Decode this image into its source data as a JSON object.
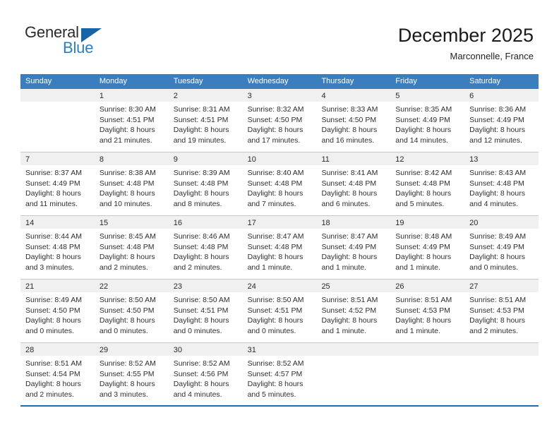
{
  "brand": {
    "name_top": "General",
    "name_bottom": "Blue",
    "triangle_icon": "blue-triangle-icon",
    "accent_color": "#2a7fc4"
  },
  "header": {
    "title": "December 2025",
    "subtitle": "Marconnelle, France"
  },
  "colors": {
    "header_row_bg": "#3b7ebf",
    "daynum_band_bg": "#f0f0f0",
    "row_divider": "#c8c8c8",
    "last_row_divider": "#1f6bb0",
    "text": "#2e2e2e"
  },
  "weekdays": [
    "Sunday",
    "Monday",
    "Tuesday",
    "Wednesday",
    "Thursday",
    "Friday",
    "Saturday"
  ],
  "weeks": [
    [
      {
        "day": "",
        "lines": []
      },
      {
        "day": "1",
        "lines": [
          "Sunrise: 8:30 AM",
          "Sunset: 4:51 PM",
          "Daylight: 8 hours",
          "and 21 minutes."
        ]
      },
      {
        "day": "2",
        "lines": [
          "Sunrise: 8:31 AM",
          "Sunset: 4:51 PM",
          "Daylight: 8 hours",
          "and 19 minutes."
        ]
      },
      {
        "day": "3",
        "lines": [
          "Sunrise: 8:32 AM",
          "Sunset: 4:50 PM",
          "Daylight: 8 hours",
          "and 17 minutes."
        ]
      },
      {
        "day": "4",
        "lines": [
          "Sunrise: 8:33 AM",
          "Sunset: 4:50 PM",
          "Daylight: 8 hours",
          "and 16 minutes."
        ]
      },
      {
        "day": "5",
        "lines": [
          "Sunrise: 8:35 AM",
          "Sunset: 4:49 PM",
          "Daylight: 8 hours",
          "and 14 minutes."
        ]
      },
      {
        "day": "6",
        "lines": [
          "Sunrise: 8:36 AM",
          "Sunset: 4:49 PM",
          "Daylight: 8 hours",
          "and 12 minutes."
        ]
      }
    ],
    [
      {
        "day": "7",
        "lines": [
          "Sunrise: 8:37 AM",
          "Sunset: 4:49 PM",
          "Daylight: 8 hours",
          "and 11 minutes."
        ]
      },
      {
        "day": "8",
        "lines": [
          "Sunrise: 8:38 AM",
          "Sunset: 4:48 PM",
          "Daylight: 8 hours",
          "and 10 minutes."
        ]
      },
      {
        "day": "9",
        "lines": [
          "Sunrise: 8:39 AM",
          "Sunset: 4:48 PM",
          "Daylight: 8 hours",
          "and 8 minutes."
        ]
      },
      {
        "day": "10",
        "lines": [
          "Sunrise: 8:40 AM",
          "Sunset: 4:48 PM",
          "Daylight: 8 hours",
          "and 7 minutes."
        ]
      },
      {
        "day": "11",
        "lines": [
          "Sunrise: 8:41 AM",
          "Sunset: 4:48 PM",
          "Daylight: 8 hours",
          "and 6 minutes."
        ]
      },
      {
        "day": "12",
        "lines": [
          "Sunrise: 8:42 AM",
          "Sunset: 4:48 PM",
          "Daylight: 8 hours",
          "and 5 minutes."
        ]
      },
      {
        "day": "13",
        "lines": [
          "Sunrise: 8:43 AM",
          "Sunset: 4:48 PM",
          "Daylight: 8 hours",
          "and 4 minutes."
        ]
      }
    ],
    [
      {
        "day": "14",
        "lines": [
          "Sunrise: 8:44 AM",
          "Sunset: 4:48 PM",
          "Daylight: 8 hours",
          "and 3 minutes."
        ]
      },
      {
        "day": "15",
        "lines": [
          "Sunrise: 8:45 AM",
          "Sunset: 4:48 PM",
          "Daylight: 8 hours",
          "and 2 minutes."
        ]
      },
      {
        "day": "16",
        "lines": [
          "Sunrise: 8:46 AM",
          "Sunset: 4:48 PM",
          "Daylight: 8 hours",
          "and 2 minutes."
        ]
      },
      {
        "day": "17",
        "lines": [
          "Sunrise: 8:47 AM",
          "Sunset: 4:48 PM",
          "Daylight: 8 hours",
          "and 1 minute."
        ]
      },
      {
        "day": "18",
        "lines": [
          "Sunrise: 8:47 AM",
          "Sunset: 4:49 PM",
          "Daylight: 8 hours",
          "and 1 minute."
        ]
      },
      {
        "day": "19",
        "lines": [
          "Sunrise: 8:48 AM",
          "Sunset: 4:49 PM",
          "Daylight: 8 hours",
          "and 1 minute."
        ]
      },
      {
        "day": "20",
        "lines": [
          "Sunrise: 8:49 AM",
          "Sunset: 4:49 PM",
          "Daylight: 8 hours",
          "and 0 minutes."
        ]
      }
    ],
    [
      {
        "day": "21",
        "lines": [
          "Sunrise: 8:49 AM",
          "Sunset: 4:50 PM",
          "Daylight: 8 hours",
          "and 0 minutes."
        ]
      },
      {
        "day": "22",
        "lines": [
          "Sunrise: 8:50 AM",
          "Sunset: 4:50 PM",
          "Daylight: 8 hours",
          "and 0 minutes."
        ]
      },
      {
        "day": "23",
        "lines": [
          "Sunrise: 8:50 AM",
          "Sunset: 4:51 PM",
          "Daylight: 8 hours",
          "and 0 minutes."
        ]
      },
      {
        "day": "24",
        "lines": [
          "Sunrise: 8:50 AM",
          "Sunset: 4:51 PM",
          "Daylight: 8 hours",
          "and 0 minutes."
        ]
      },
      {
        "day": "25",
        "lines": [
          "Sunrise: 8:51 AM",
          "Sunset: 4:52 PM",
          "Daylight: 8 hours",
          "and 1 minute."
        ]
      },
      {
        "day": "26",
        "lines": [
          "Sunrise: 8:51 AM",
          "Sunset: 4:53 PM",
          "Daylight: 8 hours",
          "and 1 minute."
        ]
      },
      {
        "day": "27",
        "lines": [
          "Sunrise: 8:51 AM",
          "Sunset: 4:53 PM",
          "Daylight: 8 hours",
          "and 2 minutes."
        ]
      }
    ],
    [
      {
        "day": "28",
        "lines": [
          "Sunrise: 8:51 AM",
          "Sunset: 4:54 PM",
          "Daylight: 8 hours",
          "and 2 minutes."
        ]
      },
      {
        "day": "29",
        "lines": [
          "Sunrise: 8:52 AM",
          "Sunset: 4:55 PM",
          "Daylight: 8 hours",
          "and 3 minutes."
        ]
      },
      {
        "day": "30",
        "lines": [
          "Sunrise: 8:52 AM",
          "Sunset: 4:56 PM",
          "Daylight: 8 hours",
          "and 4 minutes."
        ]
      },
      {
        "day": "31",
        "lines": [
          "Sunrise: 8:52 AM",
          "Sunset: 4:57 PM",
          "Daylight: 8 hours",
          "and 5 minutes."
        ]
      },
      {
        "day": "",
        "lines": []
      },
      {
        "day": "",
        "lines": []
      },
      {
        "day": "",
        "lines": []
      }
    ]
  ]
}
